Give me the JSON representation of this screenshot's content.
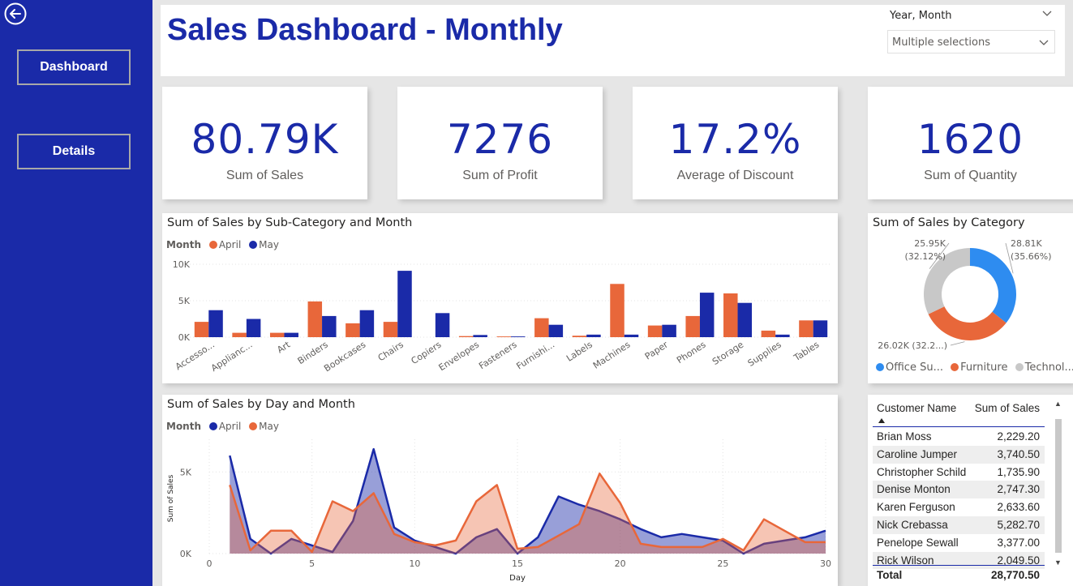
{
  "nav": {
    "buttons": [
      "Dashboard",
      "Details"
    ]
  },
  "header": {
    "title": "Sales Dashboard - Monthly",
    "slicer_label": "Year, Month",
    "slicer_value": "Multiple selections"
  },
  "kpis": [
    {
      "value": "80.79K",
      "label": "Sum of Sales"
    },
    {
      "value": "7276",
      "label": "Sum of Profit"
    },
    {
      "value": "17.2%",
      "label": "Average of Discount"
    },
    {
      "value": "1620",
      "label": "Sum of Quantity"
    }
  ],
  "colors": {
    "april_bar": "#e8673a",
    "may_bar": "#1a2aa8",
    "office": "#2e8cf0",
    "furniture": "#e8673a",
    "technology": "#c8c8c8",
    "brand": "#1a2aa8"
  },
  "chart_data": [
    {
      "type": "bar",
      "title": "Sum of Sales by Sub-Category and Month",
      "legend_title": "Month",
      "categories": [
        "Accesso...",
        "Applianc...",
        "Art",
        "Binders",
        "Bookcases",
        "Chairs",
        "Copiers",
        "Envelopes",
        "Fasteners",
        "Furnishi...",
        "Labels",
        "Machines",
        "Paper",
        "Phones",
        "Storage",
        "Supplies",
        "Tables"
      ],
      "series": [
        {
          "name": "April",
          "values": [
            2100,
            600,
            600,
            4900,
            1900,
            2100,
            0,
            150,
            100,
            2600,
            200,
            7300,
            1600,
            2900,
            6000,
            900,
            2300
          ]
        },
        {
          "name": "May",
          "values": [
            3700,
            2500,
            600,
            2900,
            3700,
            9100,
            3300,
            300,
            100,
            1700,
            350,
            350,
            1700,
            6100,
            4700,
            350,
            2300
          ]
        }
      ],
      "yticks": [
        "0K",
        "5K",
        "10K"
      ],
      "ylim": [
        0,
        10000
      ]
    },
    {
      "type": "area",
      "title": "Sum of Sales by Day and Month",
      "legend_title": "Month",
      "xlabel": "Day",
      "ylabel": "Sum of Sales",
      "xticks": [
        "0",
        "5",
        "10",
        "15",
        "20",
        "25",
        "30"
      ],
      "yticks": [
        "0K",
        "5K"
      ],
      "xlim": [
        0,
        30
      ],
      "ylim": [
        0,
        7000
      ],
      "x": [
        1,
        2,
        3,
        4,
        5,
        6,
        7,
        8,
        9,
        10,
        11,
        12,
        13,
        14,
        15,
        16,
        17,
        18,
        19,
        20,
        21,
        22,
        23,
        24,
        25,
        26,
        27,
        28,
        29,
        30
      ],
      "series": [
        {
          "name": "April",
          "values": [
            6000,
            900,
            0,
            900,
            500,
            100,
            2000,
            6400,
            1600,
            800,
            400,
            0,
            1000,
            1500,
            0,
            1000,
            3500,
            3000,
            2600,
            2100,
            1500,
            1000,
            1200,
            1000,
            800,
            0,
            600,
            800,
            1000,
            1400
          ]
        },
        {
          "name": "May",
          "values": [
            4200,
            200,
            1400,
            1400,
            100,
            3200,
            2600,
            3700,
            1200,
            700,
            500,
            800,
            3200,
            4200,
            300,
            400,
            1100,
            1800,
            4900,
            3100,
            600,
            400,
            400,
            400,
            900,
            200,
            2100,
            1400,
            700,
            700
          ]
        }
      ]
    },
    {
      "type": "pie",
      "title": "Sum of Sales by Category",
      "labels": [
        "Office Su...",
        "Furniture",
        "Technol..."
      ],
      "values": [
        28810,
        26020,
        25950
      ],
      "data_labels": [
        {
          "line1": "28.81K",
          "line2": "(35.66%)"
        },
        {
          "line1": "26.02K (32.2...)",
          "line2": ""
        },
        {
          "line1": "25.95K",
          "line2": "(32.12%)"
        }
      ]
    }
  ],
  "table": {
    "headers": [
      "Customer Name",
      "Sum of Sales"
    ],
    "rows": [
      [
        "Brian Moss",
        "2,229.20"
      ],
      [
        "Caroline Jumper",
        "3,740.50"
      ],
      [
        "Christopher Schild",
        "1,735.90"
      ],
      [
        "Denise Monton",
        "2,747.30"
      ],
      [
        "Karen Ferguson",
        "2,633.60"
      ],
      [
        "Nick Crebassa",
        "5,282.70"
      ],
      [
        "Penelope Sewall",
        "3,377.00"
      ],
      [
        "Rick Wilson",
        "2,049.50"
      ]
    ],
    "total": [
      "Total",
      "28,770.50"
    ]
  }
}
